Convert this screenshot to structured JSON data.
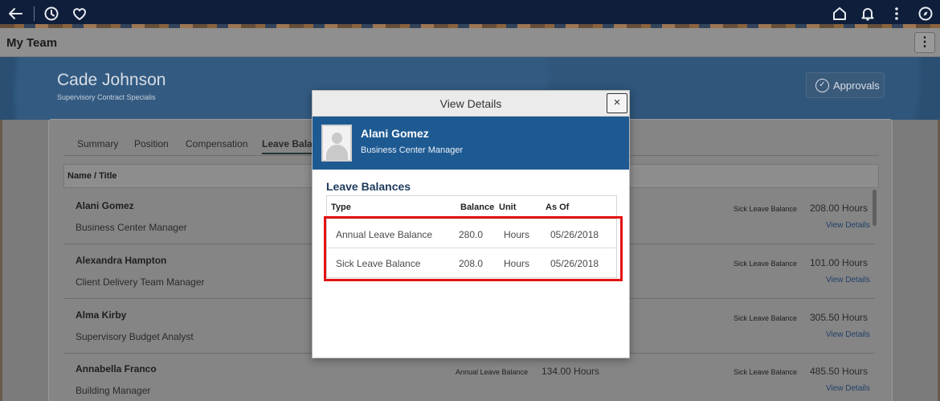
{
  "topnav": {
    "icons": [
      "back-arrow-icon",
      "history-icon",
      "favorite-heart-icon",
      "home-icon",
      "notification-bell-icon",
      "actions-menu-icon",
      "navbar-compass-icon"
    ]
  },
  "page": {
    "title": "My Team"
  },
  "employee": {
    "name": "Cade Johnson",
    "title": "Supervisory Contract Specialis"
  },
  "approvals_label": "Approvals",
  "tabs": [
    {
      "label": "Summary"
    },
    {
      "label": "Position"
    },
    {
      "label": "Compensation"
    },
    {
      "label": "Leave Balan"
    }
  ],
  "table": {
    "header": "Name / Title",
    "rows": [
      {
        "name": "Alani Gomez",
        "title": "Business Center Manager",
        "sick_label": "Sick Leave Balance",
        "sick_value": "208.00 Hours",
        "link": "View Details"
      },
      {
        "name": "Alexandra Hampton",
        "title": "Client Delivery Team Manager",
        "sick_label": "Sick Leave Balance",
        "sick_value": "101.00 Hours",
        "link": "View Details"
      },
      {
        "name": "Alma Kirby",
        "title": "Supervisory Budget Analyst",
        "sick_label": "Sick Leave Balance",
        "sick_value": "305.50 Hours",
        "link": "View Details"
      },
      {
        "name": "Annabella Franco",
        "title": "Building Manager",
        "annual_label": "Annual Leave Balance",
        "annual_value": "134.00 Hours",
        "sick_label": "Sick Leave Balance",
        "sick_value": "485.50 Hours",
        "link": "View Details"
      }
    ]
  },
  "modal": {
    "title": "View Details",
    "close_symbol": "×",
    "person": {
      "name": "Alani Gomez",
      "title": "Business Center Manager"
    },
    "section_title": "Leave Balances",
    "columns": [
      "Type",
      "Balance",
      "Unit",
      "As Of"
    ],
    "rows": [
      {
        "type": "Annual Leave Balance",
        "balance": "280.0",
        "unit": "Hours",
        "as_of": "05/26/2018"
      },
      {
        "type": "Sick Leave Balance",
        "balance": "208.0",
        "unit": "Hours",
        "as_of": "05/26/2018"
      }
    ]
  },
  "colors": {
    "highlight": "#e31212",
    "modal_header_blue": "#1e5a92",
    "nav_bg": "#0f1e3a"
  }
}
